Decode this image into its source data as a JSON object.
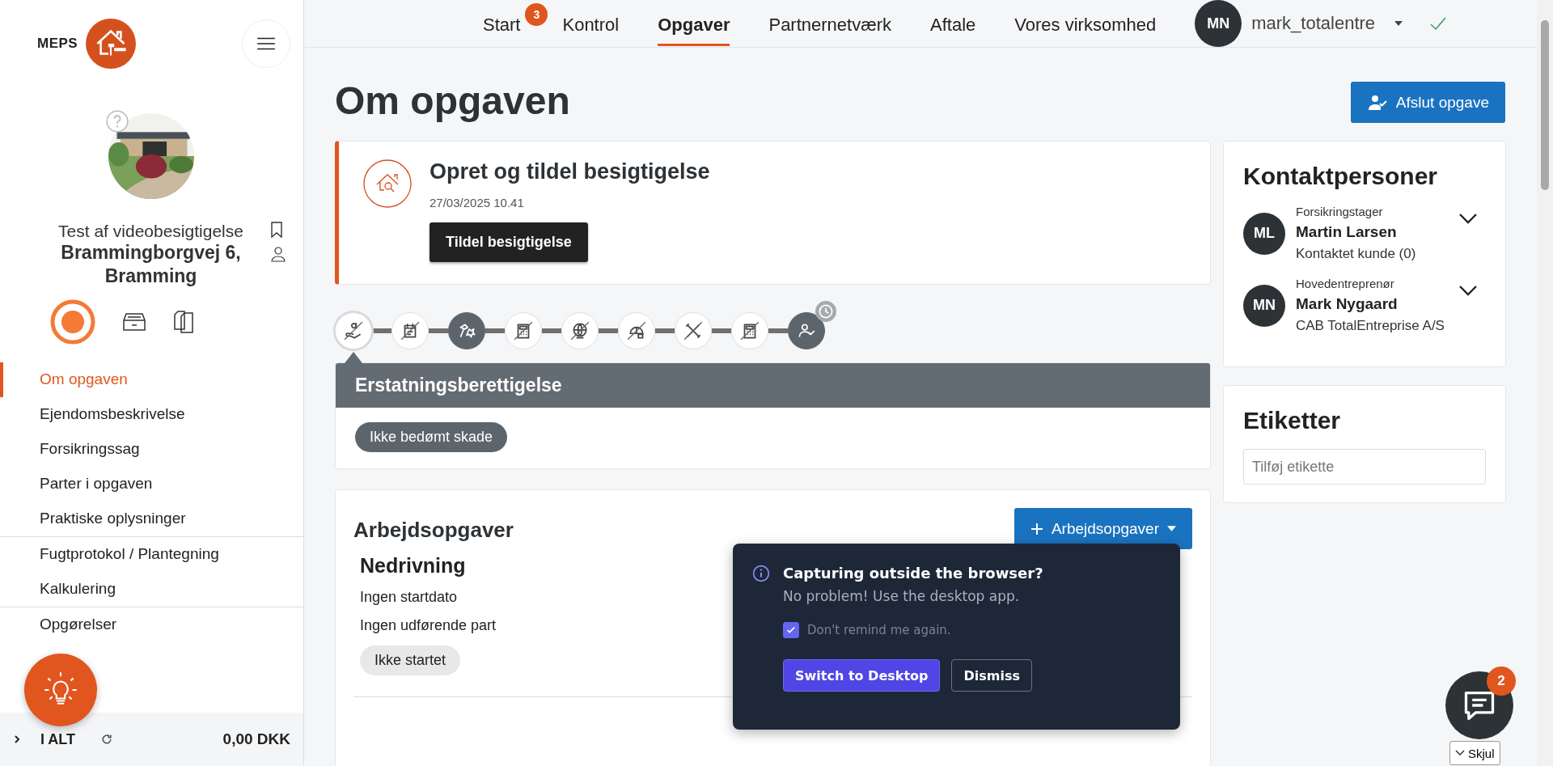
{
  "brand": {
    "name": "MEPS"
  },
  "case": {
    "title": "Test af videobesigtigelse",
    "address": "Brammingborgvej 6, Bramming"
  },
  "sidebar": {
    "groups": [
      {
        "items": [
          {
            "label": "Om opgaven",
            "selected": true
          },
          {
            "label": "Ejendomsbeskrivelse",
            "selected": false
          },
          {
            "label": "Forsikringssag",
            "selected": false
          },
          {
            "label": "Parter i opgaven",
            "selected": false
          },
          {
            "label": "Praktiske oplysninger",
            "selected": false
          }
        ]
      },
      {
        "items": [
          {
            "label": "Fugtprotokol / Plantegning",
            "selected": false
          },
          {
            "label": "Kalkulering",
            "selected": false
          }
        ]
      },
      {
        "items": [
          {
            "label": "Opgørelser",
            "selected": false
          }
        ]
      }
    ]
  },
  "footer": {
    "label": "I ALT",
    "amount": "0,00 DKK"
  },
  "nav": {
    "tabs": [
      {
        "label": "Start",
        "badge": "3",
        "selected": false
      },
      {
        "label": "Kontrol",
        "selected": false
      },
      {
        "label": "Opgaver",
        "selected": true
      },
      {
        "label": "Partnernetværk",
        "selected": false
      },
      {
        "label": "Aftale",
        "selected": false
      },
      {
        "label": "Vores virksomhed",
        "selected": false
      }
    ],
    "user": {
      "initials": "MN",
      "name": "mark_totalentre"
    }
  },
  "page": {
    "title": "Om opgaven",
    "action": "Afslut opgave"
  },
  "task": {
    "title": "Opret og tildel besigtigelse",
    "date": "27/03/2025 10.41",
    "button": "Tildel besigtigelse"
  },
  "steps": [
    {
      "kind": "money",
      "done": false,
      "selected": true,
      "pending": false
    },
    {
      "kind": "calendar",
      "done": false,
      "selected": false,
      "pending": false
    },
    {
      "kind": "hammer",
      "done": true,
      "selected": false,
      "pending": false
    },
    {
      "kind": "calculator",
      "done": false,
      "selected": false,
      "pending": false
    },
    {
      "kind": "globe",
      "done": false,
      "selected": false,
      "pending": false
    },
    {
      "kind": "bucket",
      "done": false,
      "selected": false,
      "pending": false
    },
    {
      "kind": "tools",
      "done": false,
      "selected": false,
      "pending": false
    },
    {
      "kind": "calculator",
      "done": false,
      "selected": false,
      "pending": false
    },
    {
      "kind": "person",
      "done": true,
      "selected": false,
      "pending": true
    }
  ],
  "step_panel": {
    "title": "Erstatningsberettigelse",
    "status": "Ikke bedømt skade"
  },
  "work": {
    "title": "Arbejdsopgaver",
    "button": "Arbejdsopgaver",
    "items": [
      {
        "title": "Nedrivning",
        "lines": [
          "Ingen startdato",
          "Ingen udførende part"
        ],
        "status": "Ikke startet"
      }
    ]
  },
  "contacts": {
    "title": "Kontaktpersoner",
    "people": [
      {
        "initials": "ML",
        "role": "Forsikringstager",
        "name": "Martin Larsen",
        "detail": "Kontaktet kunde (0)"
      },
      {
        "initials": "MN",
        "role": "Hovedentreprenør",
        "name": "Mark Nygaard",
        "detail": "CAB TotalEntreprise A/S"
      }
    ]
  },
  "tags": {
    "title": "Etiketter",
    "placeholder": "Tilføj etikette"
  },
  "popup": {
    "title": "Capturing outside the browser?",
    "text": "No problem! Use the desktop app.",
    "checkbox": {
      "label": "Don't remind me again.",
      "checked": true
    },
    "primary": "Switch to Desktop",
    "secondary": "Dismiss"
  },
  "chat": {
    "badge": "2",
    "hide": "Skjul"
  }
}
